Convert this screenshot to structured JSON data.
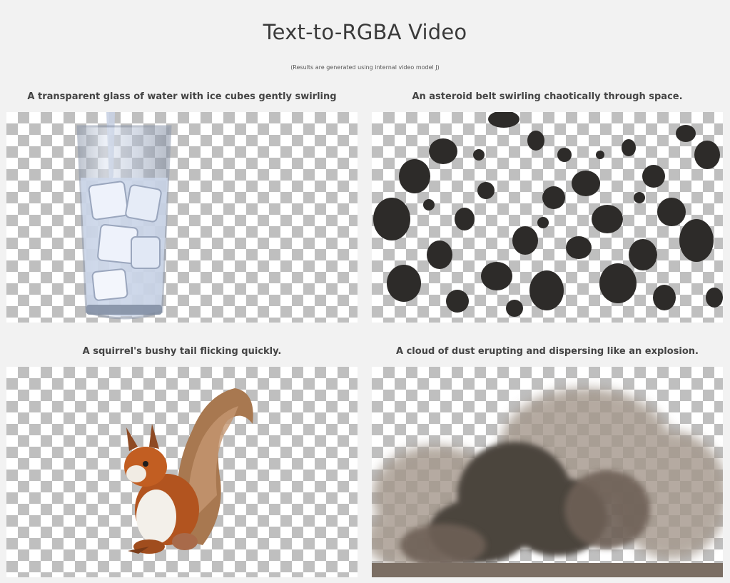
{
  "page": {
    "title": "Text-to-RGBA Video",
    "subtitle": "(Results are generated using internal video model J)"
  },
  "videos": [
    {
      "caption": "A transparent glass of water with ice cubes gently swirling",
      "subject": "glass-of-water"
    },
    {
      "caption": "An asteroid belt swirling chaotically through space.",
      "subject": "asteroids"
    },
    {
      "caption": "A squirrel's bushy tail flicking quickly.",
      "subject": "squirrel"
    },
    {
      "caption": "A cloud of dust erupting and dispersing like an explosion.",
      "subject": "dust-cloud"
    }
  ],
  "colors": {
    "background": "#f2f2f2",
    "checker_dark": "#bfbfbf",
    "checker_light": "#ffffff"
  }
}
